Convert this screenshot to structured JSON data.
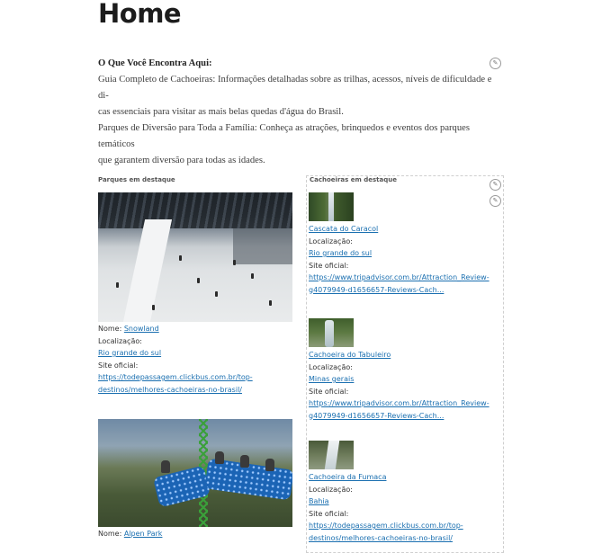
{
  "page": {
    "title": "Home"
  },
  "intro": {
    "heading": "O Que Você Encontra Aqui:",
    "paragraph1": "Guia Completo de Cachoeiras: Informações detalhadas sobre as trilhas, acessos, níveis de dificuldade e di-",
    "paragraph1_cont": "cas essenciais para visitar as mais belas quedas d'água do Brasil.",
    "paragraph2": "Parques de Diversão para Toda a Família: Conheça as atrações, brinquedos e eventos dos parques temáticos",
    "paragraph2_cont": "que garantem diversão para todas as idades."
  },
  "icons": {
    "edit": "pencil-icon"
  },
  "parks": {
    "label": "Parques em destaque",
    "items": [
      {
        "name_prefix": "Nome:",
        "name": "Snowland",
        "location_label": "Localização:",
        "location": "Rio grande do sul",
        "site_label": "Site oficial:",
        "site_line1": "https://todepassagem.clickbus.com.br/top-",
        "site_line2": "destinos/melhores-cachoeiras-no-brasil/"
      },
      {
        "name_prefix": "Nome:",
        "name": "Alpen Park"
      }
    ]
  },
  "waterfalls": {
    "label": "Cachoeiras em destaque",
    "items": [
      {
        "name": "Cascata do Caracol",
        "location_label": "Localização:",
        "location": "Rio grande do sul",
        "site_label": "Site oficial:",
        "site_line1": "https://www.tripadvisor.com.br/Attraction_Review-",
        "site_line2": "g4079949-d1656657-Reviews-Cach..."
      },
      {
        "name": "Cachoeira do Tabuleiro",
        "location_label": "Localização:",
        "location": "Minas gerais",
        "site_label": "Site oficial:",
        "site_line1": "https://www.tripadvisor.com.br/Attraction_Review-",
        "site_line2": "g4079949-d1656657-Reviews-Cach..."
      },
      {
        "name": "Cachoeira da Fumaca",
        "location_label": "Localização:",
        "location": "Bahia",
        "site_label": "Site oficial:",
        "site_line1": "https://todepassagem.clickbus.com.br/top-",
        "site_line2": "destinos/melhores-cachoeiras-no-brasil/"
      }
    ]
  },
  "colors": {
    "link": "#1a6fb0",
    "title": "#1c1c1c",
    "text": "#3d3d3d"
  }
}
